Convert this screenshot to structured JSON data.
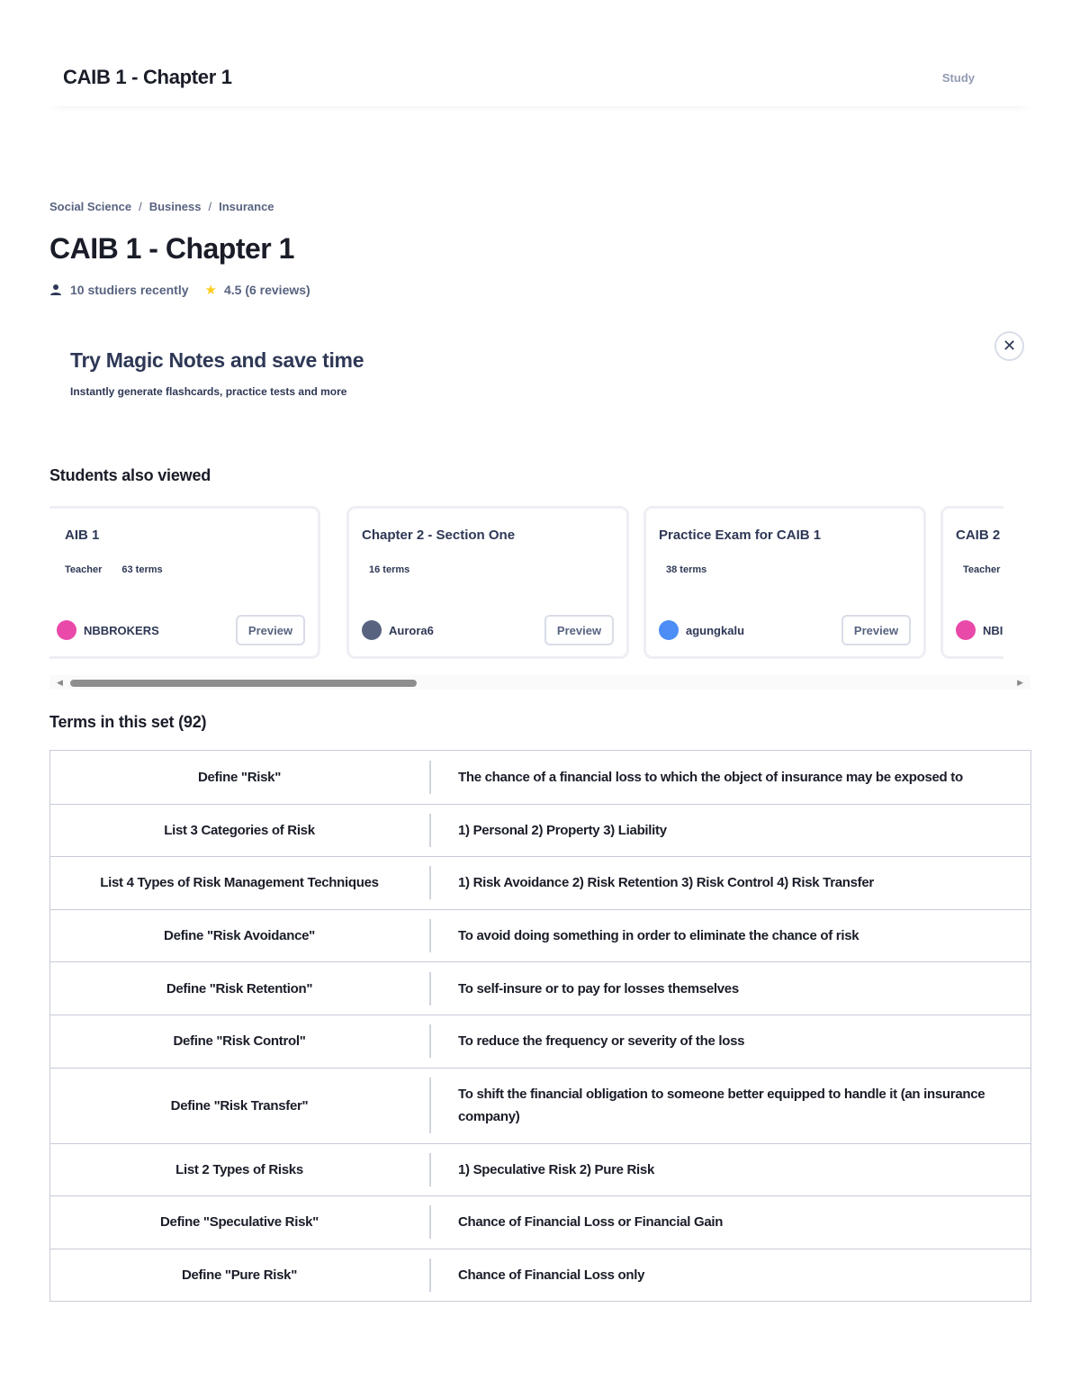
{
  "header": {
    "title": "CAIB 1 - Chapter 1",
    "study_label": "Study"
  },
  "breadcrumb": [
    "Social Science",
    "Business",
    "Insurance"
  ],
  "page": {
    "title": "CAIB 1 - Chapter 1",
    "studiers": "10 studiers recently",
    "rating": "4.5 (6 reviews)"
  },
  "promo": {
    "title": "Try Magic Notes and save time",
    "subtitle": "Instantly generate flashcards, practice tests and more",
    "close_glyph": "✕"
  },
  "also_viewed": {
    "heading": "Students also viewed",
    "cards": [
      {
        "title": "AIB 1",
        "badge": "Teacher",
        "terms": "63 terms",
        "author": "NBBROKERS",
        "avatar_color": "#e94aa9",
        "preview": "Preview"
      },
      {
        "title": "Chapter 2 - Section One",
        "badge": "",
        "terms": "16 terms",
        "author": "Aurora6",
        "avatar_color": "#586380",
        "preview": "Preview"
      },
      {
        "title": "Practice Exam for CAIB 1",
        "badge": "",
        "terms": "38 terms",
        "author": "agungkalu",
        "avatar_color": "#4c8df6",
        "preview": "Preview"
      },
      {
        "title": "CAIB 2",
        "badge": "Teacher",
        "terms": "",
        "author": "NBI",
        "avatar_color": "#e94aa9",
        "preview": ""
      }
    ]
  },
  "terms_section": {
    "heading": "Terms in this set (92)",
    "rows": [
      {
        "term": "Define \"Risk\"",
        "definition": "The chance of a financial loss to which the object of insurance may be exposed to"
      },
      {
        "term": "List 3 Categories of Risk",
        "definition": "1) Personal 2) Property 3) Liability"
      },
      {
        "term": "List 4 Types of Risk Management Techniques",
        "definition": "1) Risk Avoidance 2) Risk Retention 3) Risk Control 4) Risk Transfer"
      },
      {
        "term": "Define \"Risk Avoidance\"",
        "definition": "To avoid doing something in order to eliminate the chance of risk"
      },
      {
        "term": "Define \"Risk Retention\"",
        "definition": "To self-insure or to pay for losses themselves"
      },
      {
        "term": "Define \"Risk Control\"",
        "definition": "To reduce the frequency or severity of the loss"
      },
      {
        "term": "Define \"Risk Transfer\"",
        "definition": "To shift the financial obligation to someone better equipped to handle it (an insurance company)"
      },
      {
        "term": "List 2 Types of Risks",
        "definition": "1) Speculative Risk 2) Pure Risk"
      },
      {
        "term": "Define \"Speculative Risk\"",
        "definition": "Chance of Financial Loss or Financial Gain"
      },
      {
        "term": "Define \"Pure Risk\"",
        "definition": "Chance of Financial Loss only"
      }
    ]
  }
}
